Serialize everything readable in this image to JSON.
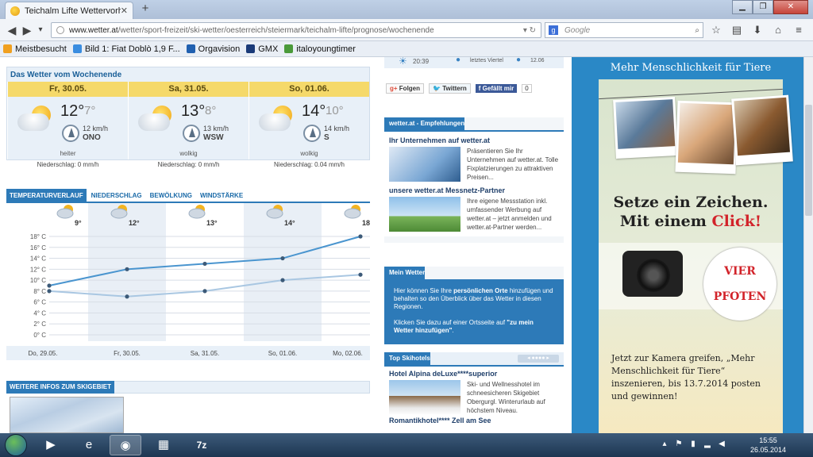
{
  "browser": {
    "tab_title": "Teichalm Lifte Wettervorhersa...",
    "new_tab": "+",
    "url_domain": "www.wetter.at",
    "url_path": "/wetter/sport-freizeit/ski-wetter/oesterreich/steiermark/teichalm-lifte/prognose/wochenende",
    "search_placeholder": "Google"
  },
  "bookmarks": [
    {
      "label": "Meistbesucht",
      "icon_color": "#f0a020"
    },
    {
      "label": "Bild 1: Fiat Doblò 1,9 F...",
      "icon_color": "#3a8de0"
    },
    {
      "label": "Orgavision",
      "icon_color": "#2060b0"
    },
    {
      "label": "GMX",
      "icon_color": "#1a3a78"
    },
    {
      "label": "italoyoungtimer",
      "icon_color": "#4a9a3a"
    }
  ],
  "topstrip": {
    "time": "20:39",
    "moon": "letztes Viertel",
    "date": "12.06"
  },
  "weekend": {
    "title": "Das Wetter vom Wochenende",
    "days": [
      {
        "day": "Fr, 30.05.",
        "tmax": "12°",
        "tmin": "7°",
        "wind_speed": "12 km/h",
        "wind_dir": "ONO",
        "desc": "heiter",
        "precip": "Niederschlag: 0 mm/h"
      },
      {
        "day": "Sa, 31.05.",
        "tmax": "13°",
        "tmin": "8°",
        "wind_speed": "13 km/h",
        "wind_dir": "WSW",
        "desc": "wolkig",
        "precip": "Niederschlag: 0 mm/h"
      },
      {
        "day": "So, 01.06.",
        "tmax": "14°",
        "tmin": "10°",
        "wind_speed": "14 km/h",
        "wind_dir": "S",
        "desc": "wolkig",
        "precip": "Niederschlag: 0.04 mm/h"
      }
    ]
  },
  "chart_tabs": [
    "TEMPERATURVERLAUF",
    "NIEDERSCHLAG",
    "BEWÖLKUNG",
    "WINDSTÄRKE"
  ],
  "chart_data": {
    "type": "line",
    "categories": [
      "Do, 29.05.",
      "Fr, 30.05.",
      "Sa, 31.05.",
      "So, 01.06.",
      "Mo, 02.06."
    ],
    "icon_labels": [
      "9°",
      "12°",
      "13°",
      "14°",
      "18°"
    ],
    "series": [
      {
        "values": [
          9,
          12,
          13,
          14,
          18
        ]
      },
      {
        "values": [
          8,
          7,
          8,
          10,
          11
        ]
      }
    ],
    "yticks": [
      "0° C",
      "2° C",
      "4° C",
      "6° C",
      "8° C",
      "10° C",
      "12° C",
      "14° C",
      "16° C",
      "18° C"
    ],
    "ylim": [
      0,
      18
    ],
    "colors": [
      "#4a95cf",
      "#a9c7e2"
    ]
  },
  "more_infos": "WEITERE INFOS ZUM SKIGEBIET",
  "social": {
    "g": "g+",
    "follow": "Folgen",
    "twitter": "Twittern",
    "facebook": "Gefällt mir",
    "fb_count": "0"
  },
  "empfehlungen": {
    "head": "wetter.at - Empfehlungen",
    "items": [
      {
        "title": "Ihr Unternehmen auf wetter.at",
        "text": "Präsentieren Sie Ihr Unternehmen auf wetter.at. Tolle Fixplatzierungen zu attraktiven Preisen..."
      },
      {
        "title": "unsere wetter.at Messnetz-Partner",
        "text": "Ihre eigene Messstation inkl. umfassender Werbung auf wetter.at – jetzt anmelden und wetter.at-Partner werden..."
      }
    ]
  },
  "mein_wetter": {
    "head": "Mein Wetter",
    "p1_a": "Hier können Sie Ihre ",
    "p1_b": "persönlichen Orte",
    "p1_c": " hinzufügen und behalten so den Überblick über das Wetter in diesen Regionen.",
    "p2_a": "Klicken Sie dazu auf einer Ortsseite auf ",
    "p2_b": "\"zu mein Wetter hinzufügen\"",
    "p2_c": "."
  },
  "skihotels": {
    "head": "Top Skihotels",
    "hotel1": "Hotel Alpina deLuxe****superior",
    "hotel1_text": "Ski- und Wellnesshotel im schneesicheren Skigebiet Obergurgl. Winterurlaub auf höchstem Niveau.",
    "hotel2": "Romantikhotel**** Zell am See"
  },
  "ad": {
    "head": "Mehr Menschlichkeit für Tiere",
    "line1": "Setze ein Zeichen.",
    "line2a": "Mit einem ",
    "line2b": "Click!",
    "logo_a": "VIER",
    "logo_b": "PFOTEN",
    "body": "Jetzt zur Kamera greifen, „Mehr Menschlichkeit für Tiere“ inszenieren, bis 13.7.2014 posten und gewinnen!"
  },
  "taskbar": {
    "time": "15:55",
    "date": "26.05.2014",
    "apps": [
      "media",
      "ie",
      "firefox",
      "explorer",
      "7z"
    ],
    "app_7z": "7z"
  }
}
